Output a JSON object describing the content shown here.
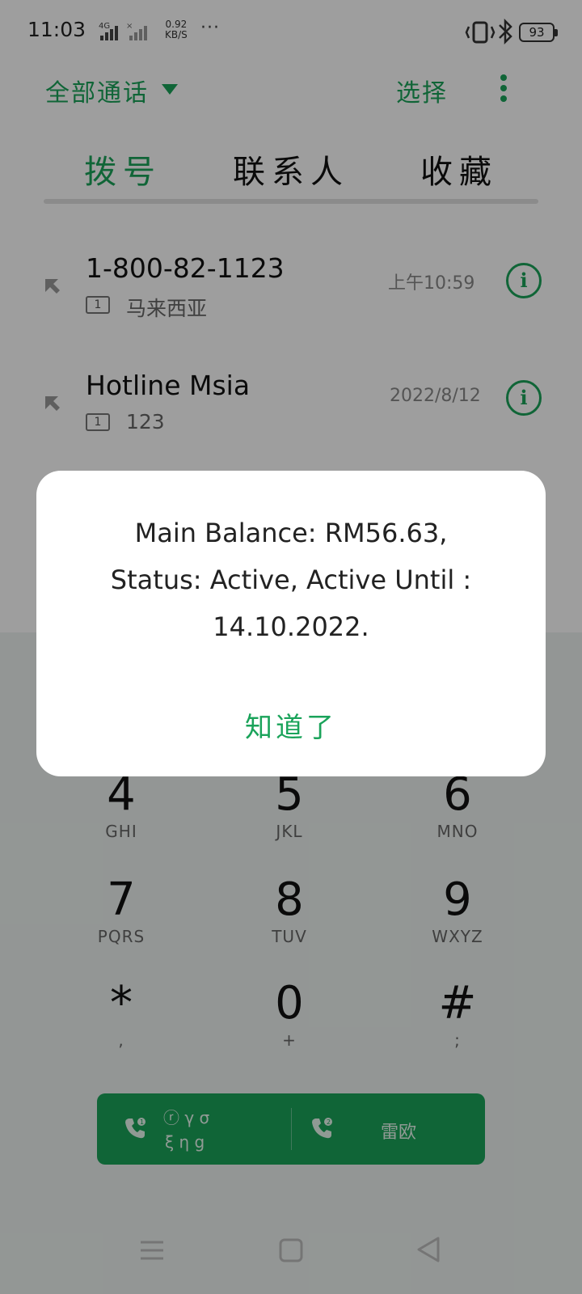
{
  "status_bar": {
    "time": "11:03",
    "network": "4G",
    "speed_value": "0.92",
    "speed_unit": "KB/S",
    "more": "···",
    "battery": "93"
  },
  "header": {
    "filter_label": "全部通话",
    "select_label": "选择"
  },
  "tabs": {
    "dial": "拨号",
    "contacts": "联系人",
    "favorites": "收藏"
  },
  "call_log": [
    {
      "title": "1-800-82-1123",
      "sim": "1",
      "subtitle": "马来西亚",
      "time": "上午10:59"
    },
    {
      "title": "Hotline Msia",
      "sim": "1",
      "subtitle": "123",
      "time": "2022/8/12"
    }
  ],
  "dialpad": {
    "keys": [
      {
        "num": "4",
        "letters": "GHI"
      },
      {
        "num": "5",
        "letters": "JKL"
      },
      {
        "num": "6",
        "letters": "MNO"
      },
      {
        "num": "7",
        "letters": "PQRS"
      },
      {
        "num": "8",
        "letters": "TUV"
      },
      {
        "num": "9",
        "letters": "WXYZ"
      },
      {
        "num": "*",
        "letters": ","
      },
      {
        "num": "0",
        "letters": "+"
      },
      {
        "num": "#",
        "letters": ";"
      }
    ]
  },
  "call_buttons": {
    "sim1_label_line1": "ⓡ γ σ",
    "sim1_label_line2": "ξ η g",
    "sim2_label": "雷欧"
  },
  "dialog": {
    "line1": "Main Balance: RM56.63,",
    "line2": "Status: Active,  Active Until :",
    "line3": "14.10.2022.",
    "ok_button": "知道了"
  },
  "colors": {
    "accent": "#1aa35a"
  }
}
